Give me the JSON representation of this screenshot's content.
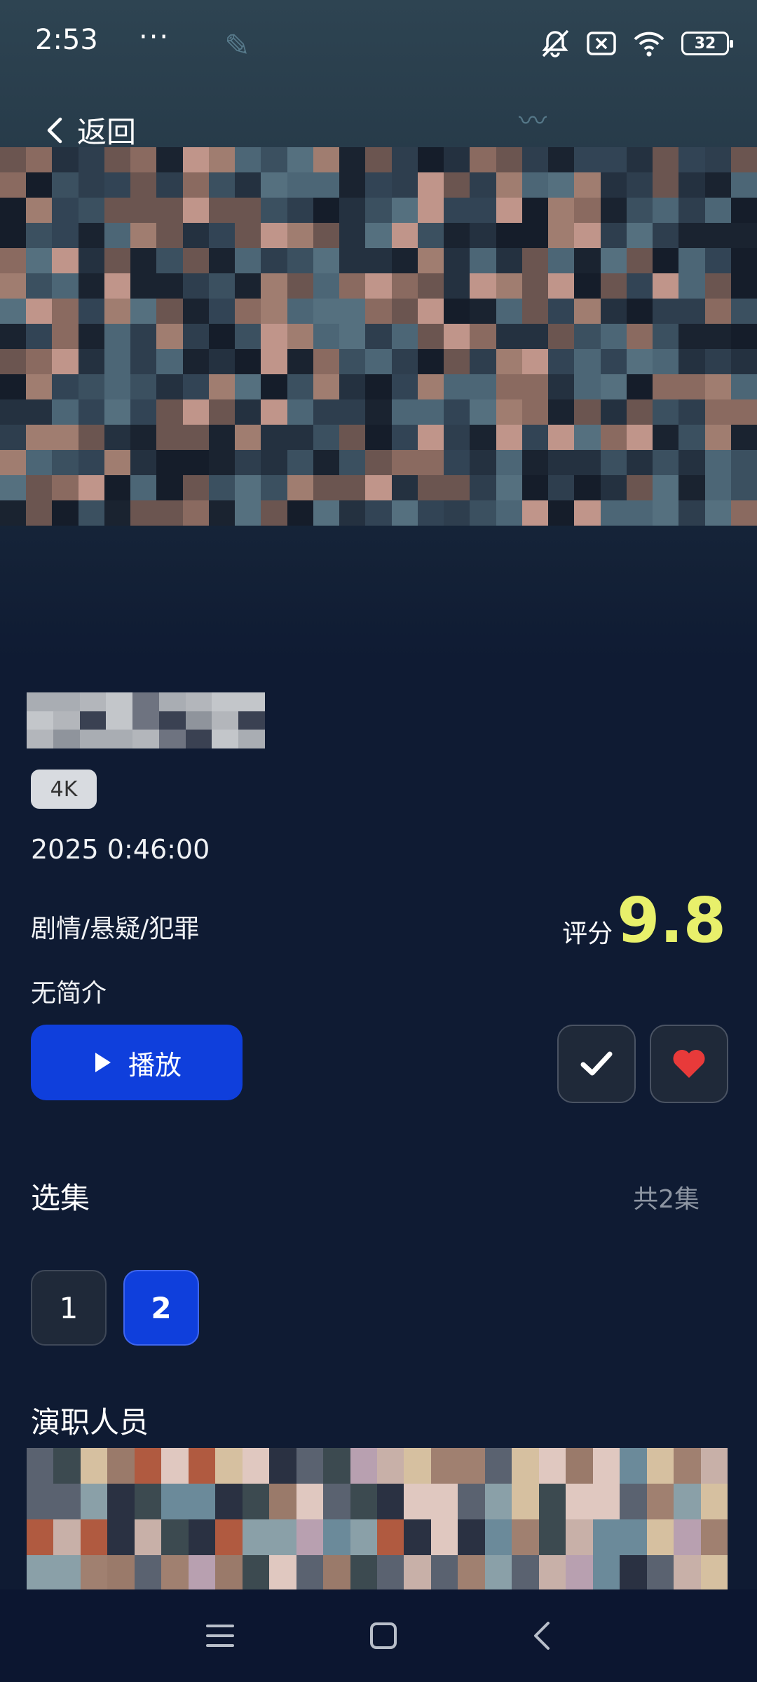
{
  "status_bar": {
    "time": "2:53",
    "more": "···",
    "battery": "32"
  },
  "nav": {
    "back_label": "返回"
  },
  "detail": {
    "badge": "4K",
    "meta": "2025 0:46:00",
    "genre": "剧情/悬疑/犯罪",
    "rating_label": "评分",
    "rating_value": "9.8",
    "intro": "无简介",
    "play_label": "播放"
  },
  "episodes": {
    "title": "选集",
    "count_label": "共2集",
    "items": [
      "1",
      "2"
    ],
    "selected": "2"
  },
  "cast": {
    "title": "演职人员"
  },
  "colors": {
    "accent": "#0f3fdc",
    "rating": "#e8f06b",
    "background": "#0f1b33",
    "heart": "#e83a3a"
  },
  "icons": [
    "back-chevron-icon",
    "mute-icon",
    "sim-x-icon",
    "wifi-icon",
    "battery-icon",
    "play-icon",
    "check-icon",
    "heart-icon",
    "menu-icon",
    "home-icon",
    "back-nav-icon"
  ]
}
